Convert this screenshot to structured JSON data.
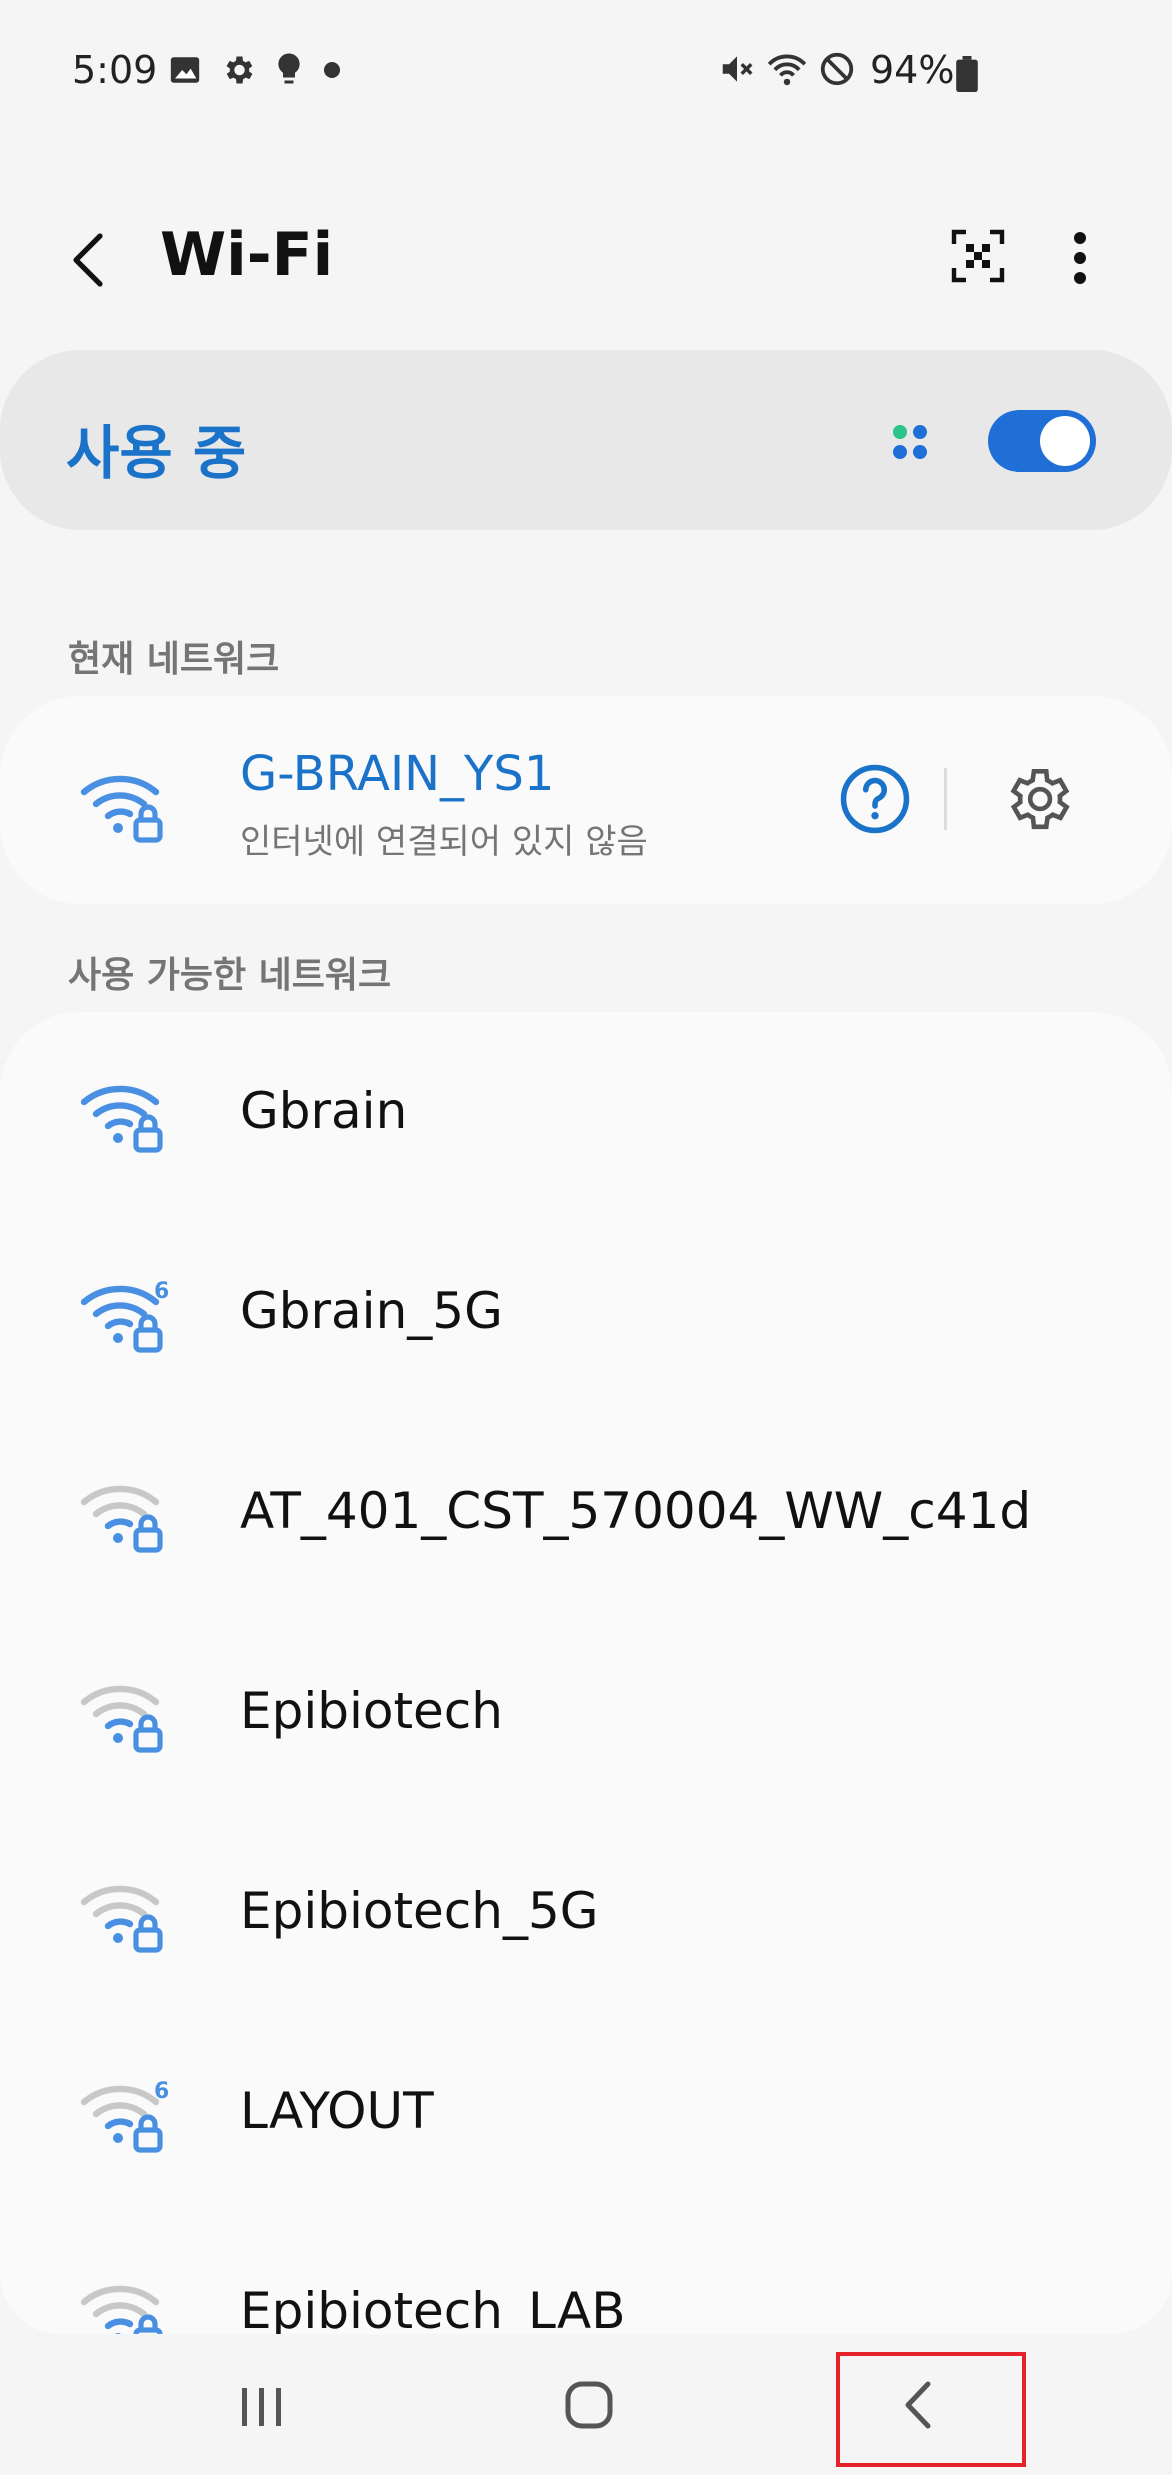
{
  "status_bar": {
    "time": "5:09",
    "battery": "94%",
    "icons_left": [
      "gallery-icon",
      "settings-icon",
      "bulb-icon",
      "dot-icon"
    ],
    "icons_right": [
      "mute-icon",
      "wifi-status-icon",
      "block-icon",
      "battery-icon"
    ]
  },
  "header": {
    "title": "Wi-Fi",
    "back_icon": "back-icon",
    "qr_icon": "qr-code-icon",
    "more_icon": "more-vert-icon"
  },
  "wifi_toggle": {
    "label": "사용 중",
    "state": "on",
    "accent": "#1f6fd6"
  },
  "current_network": {
    "section_label": "현재 네트워크",
    "name": "G-BRAIN_YS1",
    "status": "인터넷에 연결되어 있지 않음"
  },
  "available_networks": {
    "section_label": "사용 가능한 네트워크",
    "items": [
      {
        "name": "Gbrain",
        "strength": "strong",
        "wifi6": false
      },
      {
        "name": "Gbrain_5G",
        "strength": "strong",
        "wifi6": true
      },
      {
        "name": "AT_401_CST_570004_WW_c41d",
        "strength": "weak",
        "wifi6": false
      },
      {
        "name": "Epibiotech",
        "strength": "weak",
        "wifi6": false
      },
      {
        "name": "Epibiotech_5G",
        "strength": "weak",
        "wifi6": false
      },
      {
        "name": "LAYOUT",
        "strength": "weak",
        "wifi6": true
      },
      {
        "name": "Epibiotech_LAB",
        "strength": "weak",
        "wifi6": false
      }
    ]
  },
  "nav_bar": {
    "recents_icon": "recents-icon",
    "home_icon": "home-icon",
    "back_icon": "nav-back-icon"
  },
  "colors": {
    "accent": "#1a73c8",
    "highlight_box": "#e5222a"
  }
}
